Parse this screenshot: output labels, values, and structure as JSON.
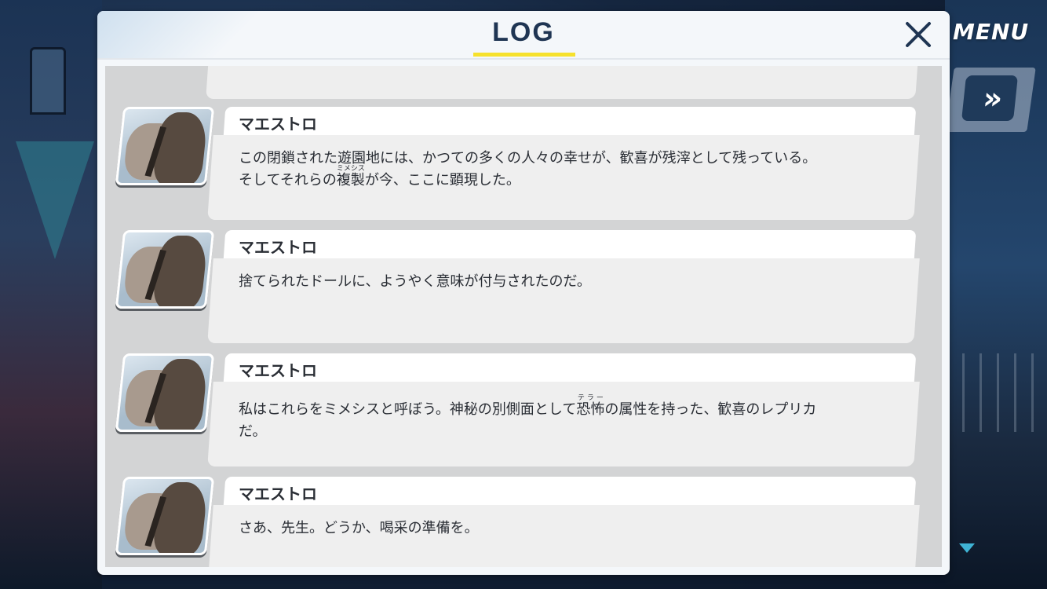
{
  "window": {
    "title": "LOG",
    "accent_color": "#f6e12c",
    "close_icon": "close-icon"
  },
  "hud": {
    "menu_label": "MENU",
    "skip_icon": "fast-forward-icon",
    "scroll_icon": "down-arrow-icon"
  },
  "entries": [
    {
      "speaker": "マエストロ",
      "text": "この閉鎖された遊園地には、かつての多くの人々の幸せが、歓喜が残滓として残っている。\nそしてそれらの複製が今、ここに顕現した。",
      "ruby": "ミメシス"
    },
    {
      "speaker": "マエストロ",
      "text": "捨てられたドールに、ようやく意味が付与されたのだ。"
    },
    {
      "speaker": "マエストロ",
      "text": "私はこれらをミメシスと呼ぼう。神秘の別側面として恐怖の属性を持った、歓喜のレプリカだ。",
      "ruby": "テラー"
    },
    {
      "speaker": "マエストロ",
      "text": "さあ、先生。どうか、喝采の準備を。"
    }
  ]
}
